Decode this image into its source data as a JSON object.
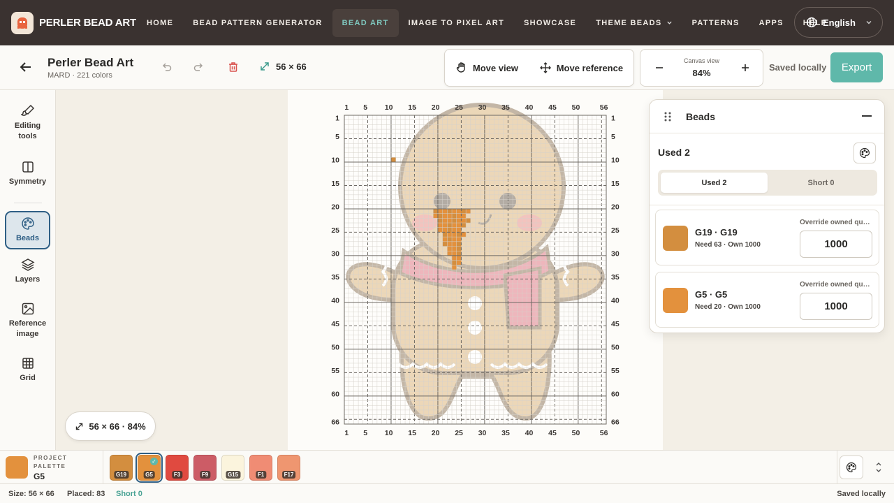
{
  "nav": {
    "brand": "PERLER BEAD ART",
    "links": [
      "HOME",
      "BEAD PATTERN GENERATOR",
      "BEAD ART",
      "IMAGE TO PIXEL ART",
      "SHOWCASE",
      "THEME BEADS",
      "PATTERNS",
      "APPS",
      "HELP"
    ],
    "active_index": 2,
    "dropdown_index": 5,
    "language": "English"
  },
  "toolbar": {
    "title": "Perler Bead Art",
    "subtitle": "MARD · 221 colors",
    "dimensions": "56 × 66",
    "move_view": "Move view",
    "move_reference": "Move reference",
    "canvas_view_label": "Canvas view",
    "zoom": "84%",
    "saved": "Saved locally",
    "export": "Export"
  },
  "sidebar": {
    "items": [
      {
        "label1": "Editing",
        "label2": "tools",
        "icon": "brush-icon"
      },
      {
        "label1": "Symmetry",
        "label2": "",
        "icon": "symmetry-icon"
      },
      {
        "label1": "Beads",
        "label2": "",
        "icon": "palette-icon"
      },
      {
        "label1": "Layers",
        "label2": "",
        "icon": "layers-icon"
      },
      {
        "label1": "Reference",
        "label2": "image",
        "icon": "image-icon"
      },
      {
        "label1": "Grid",
        "label2": "",
        "icon": "grid-icon"
      }
    ],
    "active_index": 2
  },
  "canvas": {
    "zoom_chip": "56 × 66 · 84%",
    "cols": 56,
    "rows": 66,
    "top_labels": [
      "1",
      "5",
      "10",
      "15",
      "20",
      "25",
      "30",
      "35",
      "40",
      "45",
      "50",
      "56"
    ],
    "side_labels": [
      "1",
      "5",
      "10",
      "15",
      "20",
      "25",
      "30",
      "35",
      "40",
      "45",
      "50",
      "55",
      "60",
      "66"
    ]
  },
  "beads_panel": {
    "title": "Beads",
    "used_heading": "Used 2",
    "tab_used": "Used 2",
    "tab_short": "Short 0",
    "rows": [
      {
        "name": "G19 · G19",
        "need": "Need 63 · Own 1000",
        "override_label": "Override owned quantity",
        "qty": "1000",
        "color": "#d38e3f"
      },
      {
        "name": "G5 · G5",
        "need": "Need 20 · Own 1000",
        "override_label": "Override owned quantity",
        "qty": "1000",
        "color": "#e3913d"
      }
    ]
  },
  "palette": {
    "label_line1": "PROJECT",
    "label_line2": "PALETTE",
    "current": "G5",
    "current_color": "#e3913d",
    "chips": [
      {
        "code": "G19",
        "color": "#d38e3f"
      },
      {
        "code": "G5",
        "color": "#e3913d"
      },
      {
        "code": "F3",
        "color": "#e04a40"
      },
      {
        "code": "F9",
        "color": "#cc5c66"
      },
      {
        "code": "G15",
        "color": "#fbf4dd"
      },
      {
        "code": "F1",
        "color": "#f08c74"
      },
      {
        "code": "F17",
        "color": "#ef9670"
      }
    ],
    "selected_index": 1
  },
  "status": {
    "size": "Size: 56 × 66",
    "placed": "Placed: 83",
    "short": "Short 0",
    "saved": "Saved locally"
  },
  "colors": {
    "nav_bg": "#3a3230",
    "accent": "#5fb8aa",
    "active_blue": "#2f5f85",
    "short_text": "#4aa395"
  }
}
